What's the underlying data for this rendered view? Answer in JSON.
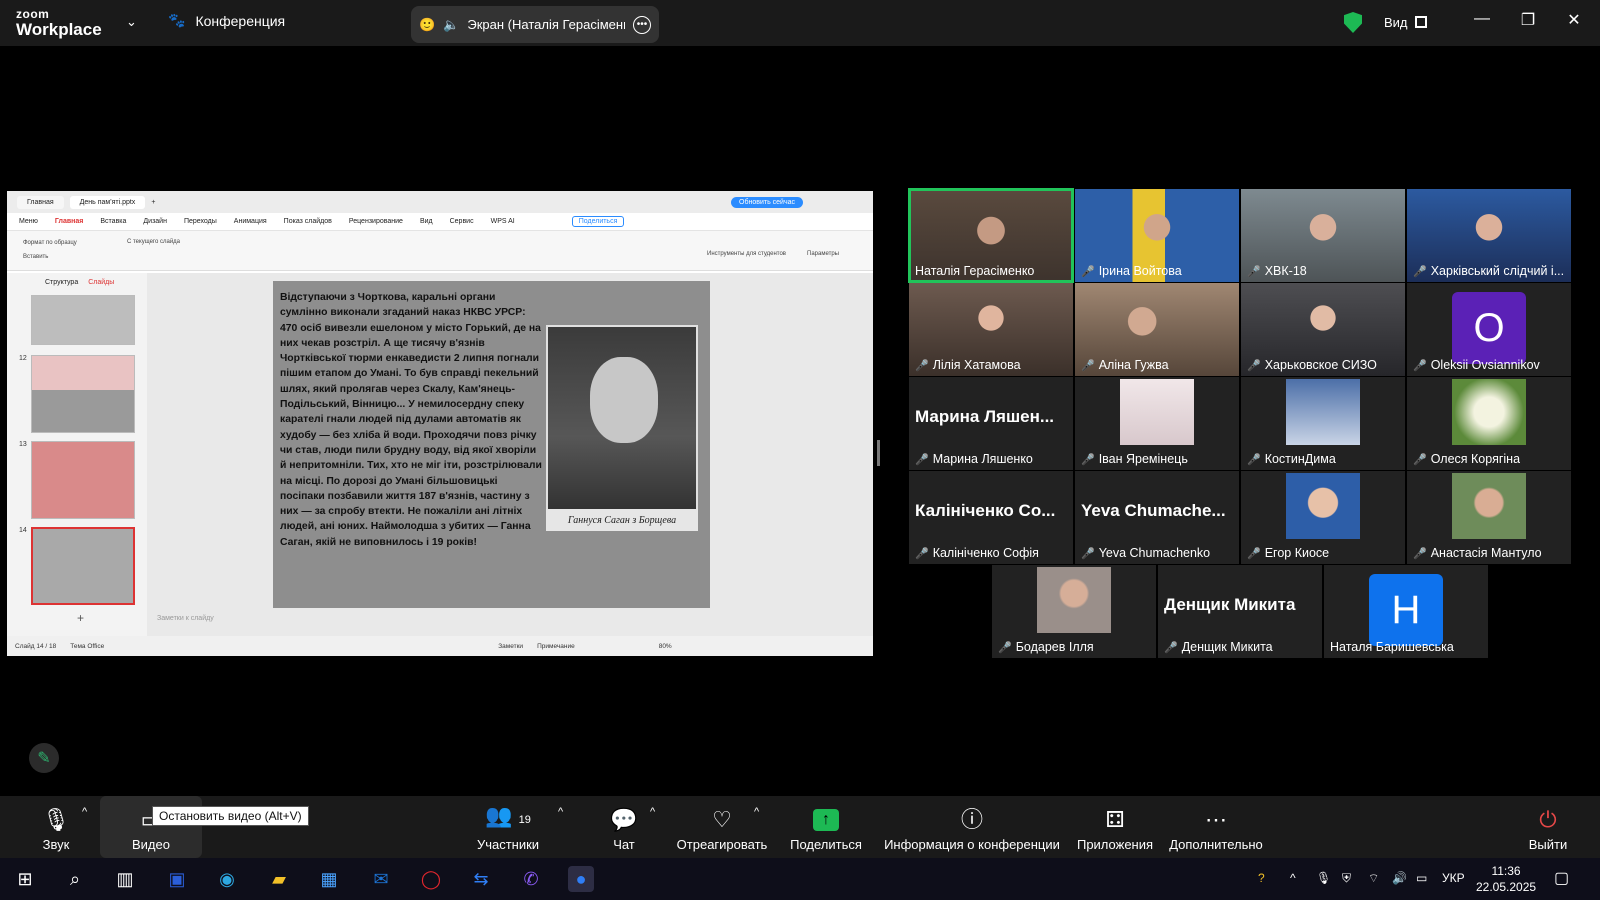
{
  "topbar": {
    "logo_top": "zoom",
    "logo_bottom": "Workplace",
    "meeting_label": "Конференция",
    "share_title": "Экран (Наталія Герасіменко)",
    "view_label": "Вид"
  },
  "wps": {
    "tab_home": "Главная",
    "tab_file": "День пам'яті.pptx",
    "update_btn": "Обновить сейчас",
    "menu": [
      "Меню",
      "Главная",
      "Вставка",
      "Дизайн",
      "Переходы",
      "Анимация",
      "Показ слайдов",
      "Рецензирование",
      "Вид",
      "Сервис",
      "WPS AI"
    ],
    "share_btn": "Поделиться",
    "ribbon_format": "Формат по образцу",
    "ribbon_insert": "Вставить",
    "ribbon_from_current": "С текущего слайда",
    "ribbon_students": "Инструменты для студентов",
    "ribbon_params": "Параметры",
    "side_tab_structure": "Структура",
    "side_tab_slides": "Слайды",
    "thumb_numbers": [
      "12",
      "13",
      "14"
    ],
    "notes_placeholder": "Заметки к слайду",
    "status_slide": "Слайд 14 / 18",
    "status_theme": "Тема Office",
    "status_notes": "Заметки",
    "status_comment": "Примечание",
    "status_zoom": "80%"
  },
  "slide": {
    "text": "Відступаючи з Чорткова, каральні органи сумлінно виконали згаданий наказ НКВС УРСР: 470 осіб вивезли ешелоном у місто Горький, де на них чекав розстріл. А ще тисячу в'язнів Чортківської тюрми енкаведисти 2 липня погнали пішим етапом до Умані. То був справді пекельний шлях, який пролягав через Скалу, Кам'янець-Подільський, Вінницю... У немилосердну спеку карателі гнали людей під дулами автоматів як худобу — без хліба й води. Проходячи повз річку чи став, люди пили брудну воду, від якої хворіли й непритомніли. Тих, хто не міг іти, розстрілювали на місці. По дорозі до Умані більшовицькі посіпаки позбавили життя 187 в'язнів, частину з них — за спробу втекти. Не пожаліли ані літніх людей, ані юних. Наймолодша з убитих — Ганна Саган, якій не виповнилось і 19 років!",
    "photo_caption": "Ганнуся Саган з Борщева"
  },
  "participants": [
    {
      "name": "Наталія Герасіменко",
      "muted": false,
      "active": true
    },
    {
      "name": "Ірина Войтова",
      "muted": true
    },
    {
      "name": "ХВК-18",
      "muted": true
    },
    {
      "name": "Харківський слідчий і...",
      "muted": true
    },
    {
      "name": "Лілія Хатамова",
      "muted": true
    },
    {
      "name": "Аліна Гужва",
      "muted": true
    },
    {
      "name": "Харьковское СИЗО",
      "muted": true
    },
    {
      "name": "Oleksii Ovsiannikov",
      "muted": true,
      "avatar_letter": "O",
      "avatar_color": "#5b21b6"
    },
    {
      "name": "Марина Ляшенко",
      "muted": true,
      "big_name": "Марина Ляшен..."
    },
    {
      "name": "Іван Яремінець",
      "muted": true
    },
    {
      "name": "КостинДима",
      "muted": true
    },
    {
      "name": "Олеся Корягіна",
      "muted": true
    },
    {
      "name": "Калініченко Софія",
      "muted": true,
      "big_name": "Калініченко Со..."
    },
    {
      "name": "Yeva Chumachenko",
      "muted": true,
      "big_name": "Yeva Chumache..."
    },
    {
      "name": "Егор Киосе",
      "muted": true
    },
    {
      "name": "Анастасія Мантуло",
      "muted": true
    },
    {
      "name": "Бодарев Ілля",
      "muted": true
    },
    {
      "name": "Денщик Микита",
      "muted": true,
      "big_name": "Денщик Микита"
    },
    {
      "name": "Наталя Баришевська",
      "muted": false,
      "avatar_letter": "H",
      "avatar_color": "#0e72ed"
    }
  ],
  "toolbar": {
    "audio": "Звук",
    "video": "Видео",
    "video_tooltip": "Остановить видео (Alt+V)",
    "participants": "Участники",
    "participants_count": "19",
    "chat": "Чат",
    "react": "Отреагировать",
    "share": "Поделиться",
    "info": "Информация о конференции",
    "apps": "Приложения",
    "more": "Дополнительно",
    "leave": "Выйти"
  },
  "taskbar": {
    "lang": "УКР",
    "time": "11:36",
    "date": "22.05.2025"
  },
  "colors": {
    "active_speaker": "#21c45a",
    "muted_icon": "#e54848",
    "share_green": "#1db954"
  }
}
